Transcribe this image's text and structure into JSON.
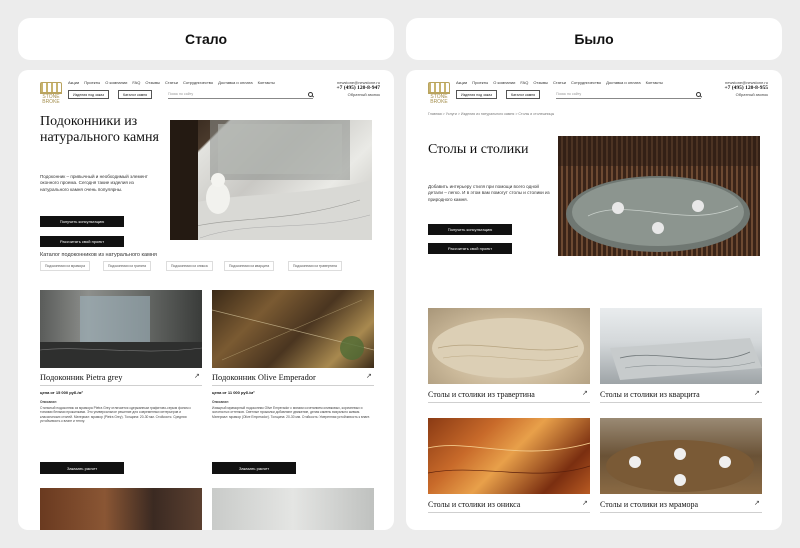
{
  "labels": {
    "left": "Стало",
    "right": "Было"
  },
  "header": {
    "logo_text": "STONE BROKE",
    "nav": [
      "Акции",
      "Проекты",
      "О компании",
      "FAQ",
      "Отзывы",
      "Статьи",
      "Сотрудничество",
      "Доставка и оплата",
      "Контакты"
    ],
    "btn_order": "Изделия под заказ",
    "btn_catalog": "Каталог камня",
    "search_placeholder": "Поиск по сайту",
    "email": "newstone@newstone.ru",
    "phone_left": "+7 (495) 120-8-947",
    "phone_right": "+7 (495) 120-8-955",
    "callback": "Обратный звонок"
  },
  "after": {
    "title": "Подоконники из натурального камня",
    "lead": "Подоконник – привычный и необходимый элемент оконного проема. Сегодня такие изделия из натурального камня очень популярны.",
    "btn_consult": "Получить консультацию",
    "btn_calc": "Рассчитать свой проект",
    "catalog_title": "Каталог подоконников из натурального камня",
    "chips": [
      "Подоконники из мрамора",
      "Подоконники из гранита",
      "Подоконники из оникса",
      "Подоконники из кварцита",
      "Подоконники из травертина"
    ],
    "products": [
      {
        "title": "Подоконник Pietra grey",
        "price": "цена от 15 000 руб./м²",
        "desc_label": "Описание:",
        "desc": "Стильный подоконник из мрамора Pietra Grey отличается сдержанным графитово-серым фоном с тонкими белыми прожилками. Это универсальное решение для современных интерьеров и классических стилей. Материал: мрамор (Pietra Grey). Толщина: 20-30 мм. Стойкость: Средняя устойчивость к влаге и теплу.",
        "button": "Заказать расчет"
      },
      {
        "title": "Подоконник Olive Emperador",
        "price": "цена от 11 000 руб./м²",
        "desc_label": "Описание:",
        "desc": "Изящный мраморный подоконник Olive Emperador с мягким сочетанием оливковых, коричневых и золотистых оттенков. Светлые прожилки добавляют движение, делая камень визуально живым. Материал: мрамор (Olive Emperador). Толщина: 20-30 мм. Стойкость: Умеренная устойчивость к влаге.",
        "button": "Заказать расчет"
      }
    ]
  },
  "before": {
    "breadcrumbs": "Главная  >  Услуги  >  Изделия из натурального камня  >  Столы и столешницы",
    "title": "Столы и столики",
    "lead": "Добавить интерьеру стиля при помощи всего одной детали – легко. И в этом вам помогут столы и столики из природного камня.",
    "btn_consult": "Получить консультацию",
    "btn_calc": "Рассчитать свой проект",
    "products": [
      "Столы и столики из травертина",
      "Столы и столики из кварцита",
      "Столы и столики из оникса",
      "Столы и столики из мрамора"
    ]
  },
  "colors": {
    "background": "#ececec",
    "dark_button": "#111111",
    "logo_gold": "#b9a35e"
  }
}
